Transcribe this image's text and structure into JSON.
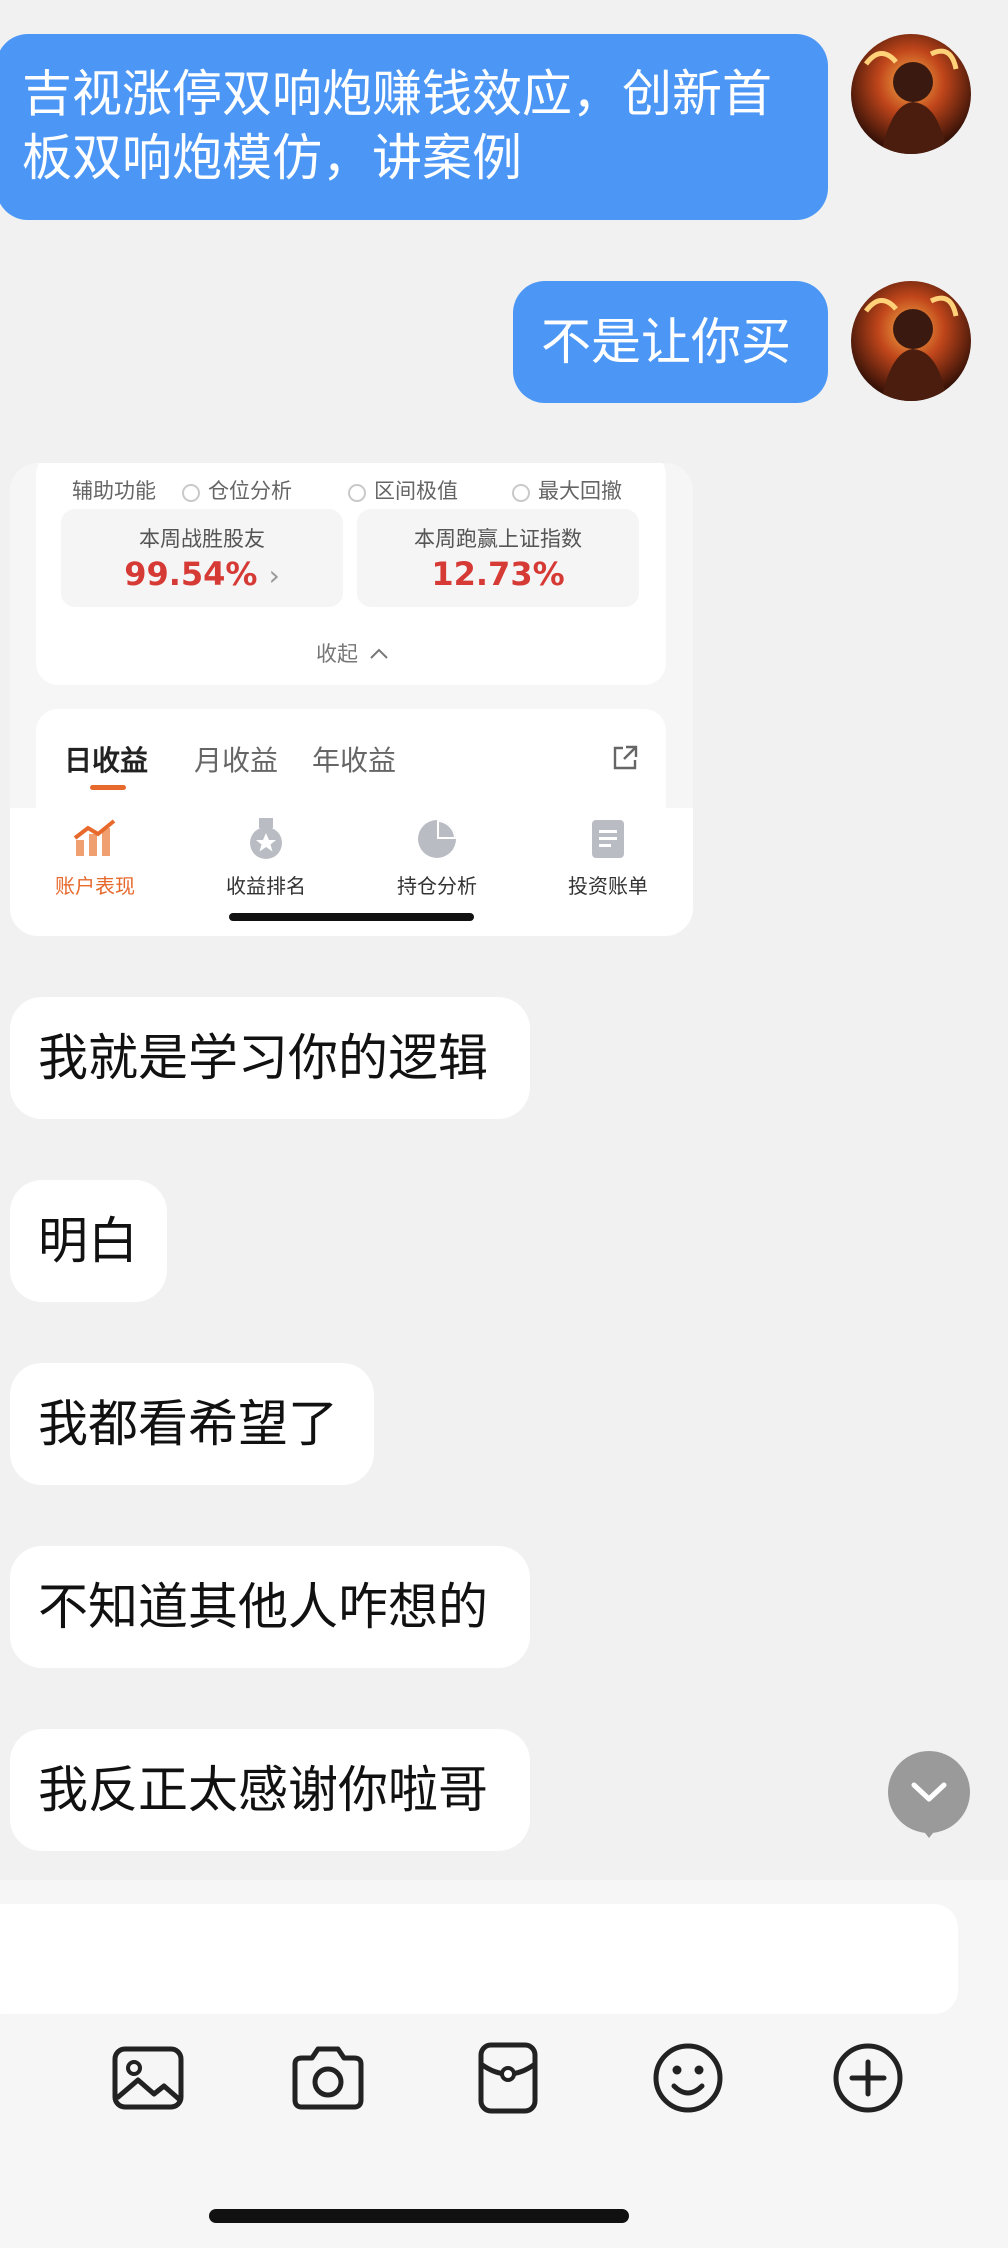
{
  "messages": {
    "m1": {
      "line1": "吉视涨停双响炮赚钱效应，创新首",
      "line2": "板双响炮模仿，讲案例"
    },
    "m2": "不是让你买",
    "m3": "我就是学习你的逻辑",
    "m4": "明白",
    "m5": "我都看希望了",
    "m6": "不知道其他人咋想的",
    "m7": "我反正太感谢你啦哥"
  },
  "shared_card": {
    "aux_label": "辅助功能",
    "options": [
      "仓位分析",
      "区间极值",
      "最大回撤"
    ],
    "stat1_label": "本周战胜股友",
    "stat1_value": "99.54%",
    "stat1_arrow": "›",
    "stat2_label": "本周跑赢上证指数",
    "stat2_value": "12.73%",
    "collapse_label": "收起",
    "tabs": [
      "日收益",
      "月收益",
      "年收益"
    ],
    "nav": [
      "账户表现",
      "收益排名",
      "持仓分析",
      "投资账单"
    ]
  },
  "colors": {
    "outgoing_bubble": "#4c97f6",
    "accent_orange": "#e8692c",
    "stat_red": "#d63a35"
  },
  "icons": [
    "image-icon",
    "camera-icon",
    "red-packet-icon",
    "emoji-icon",
    "plus-icon",
    "chevron-down-icon",
    "share-icon"
  ]
}
